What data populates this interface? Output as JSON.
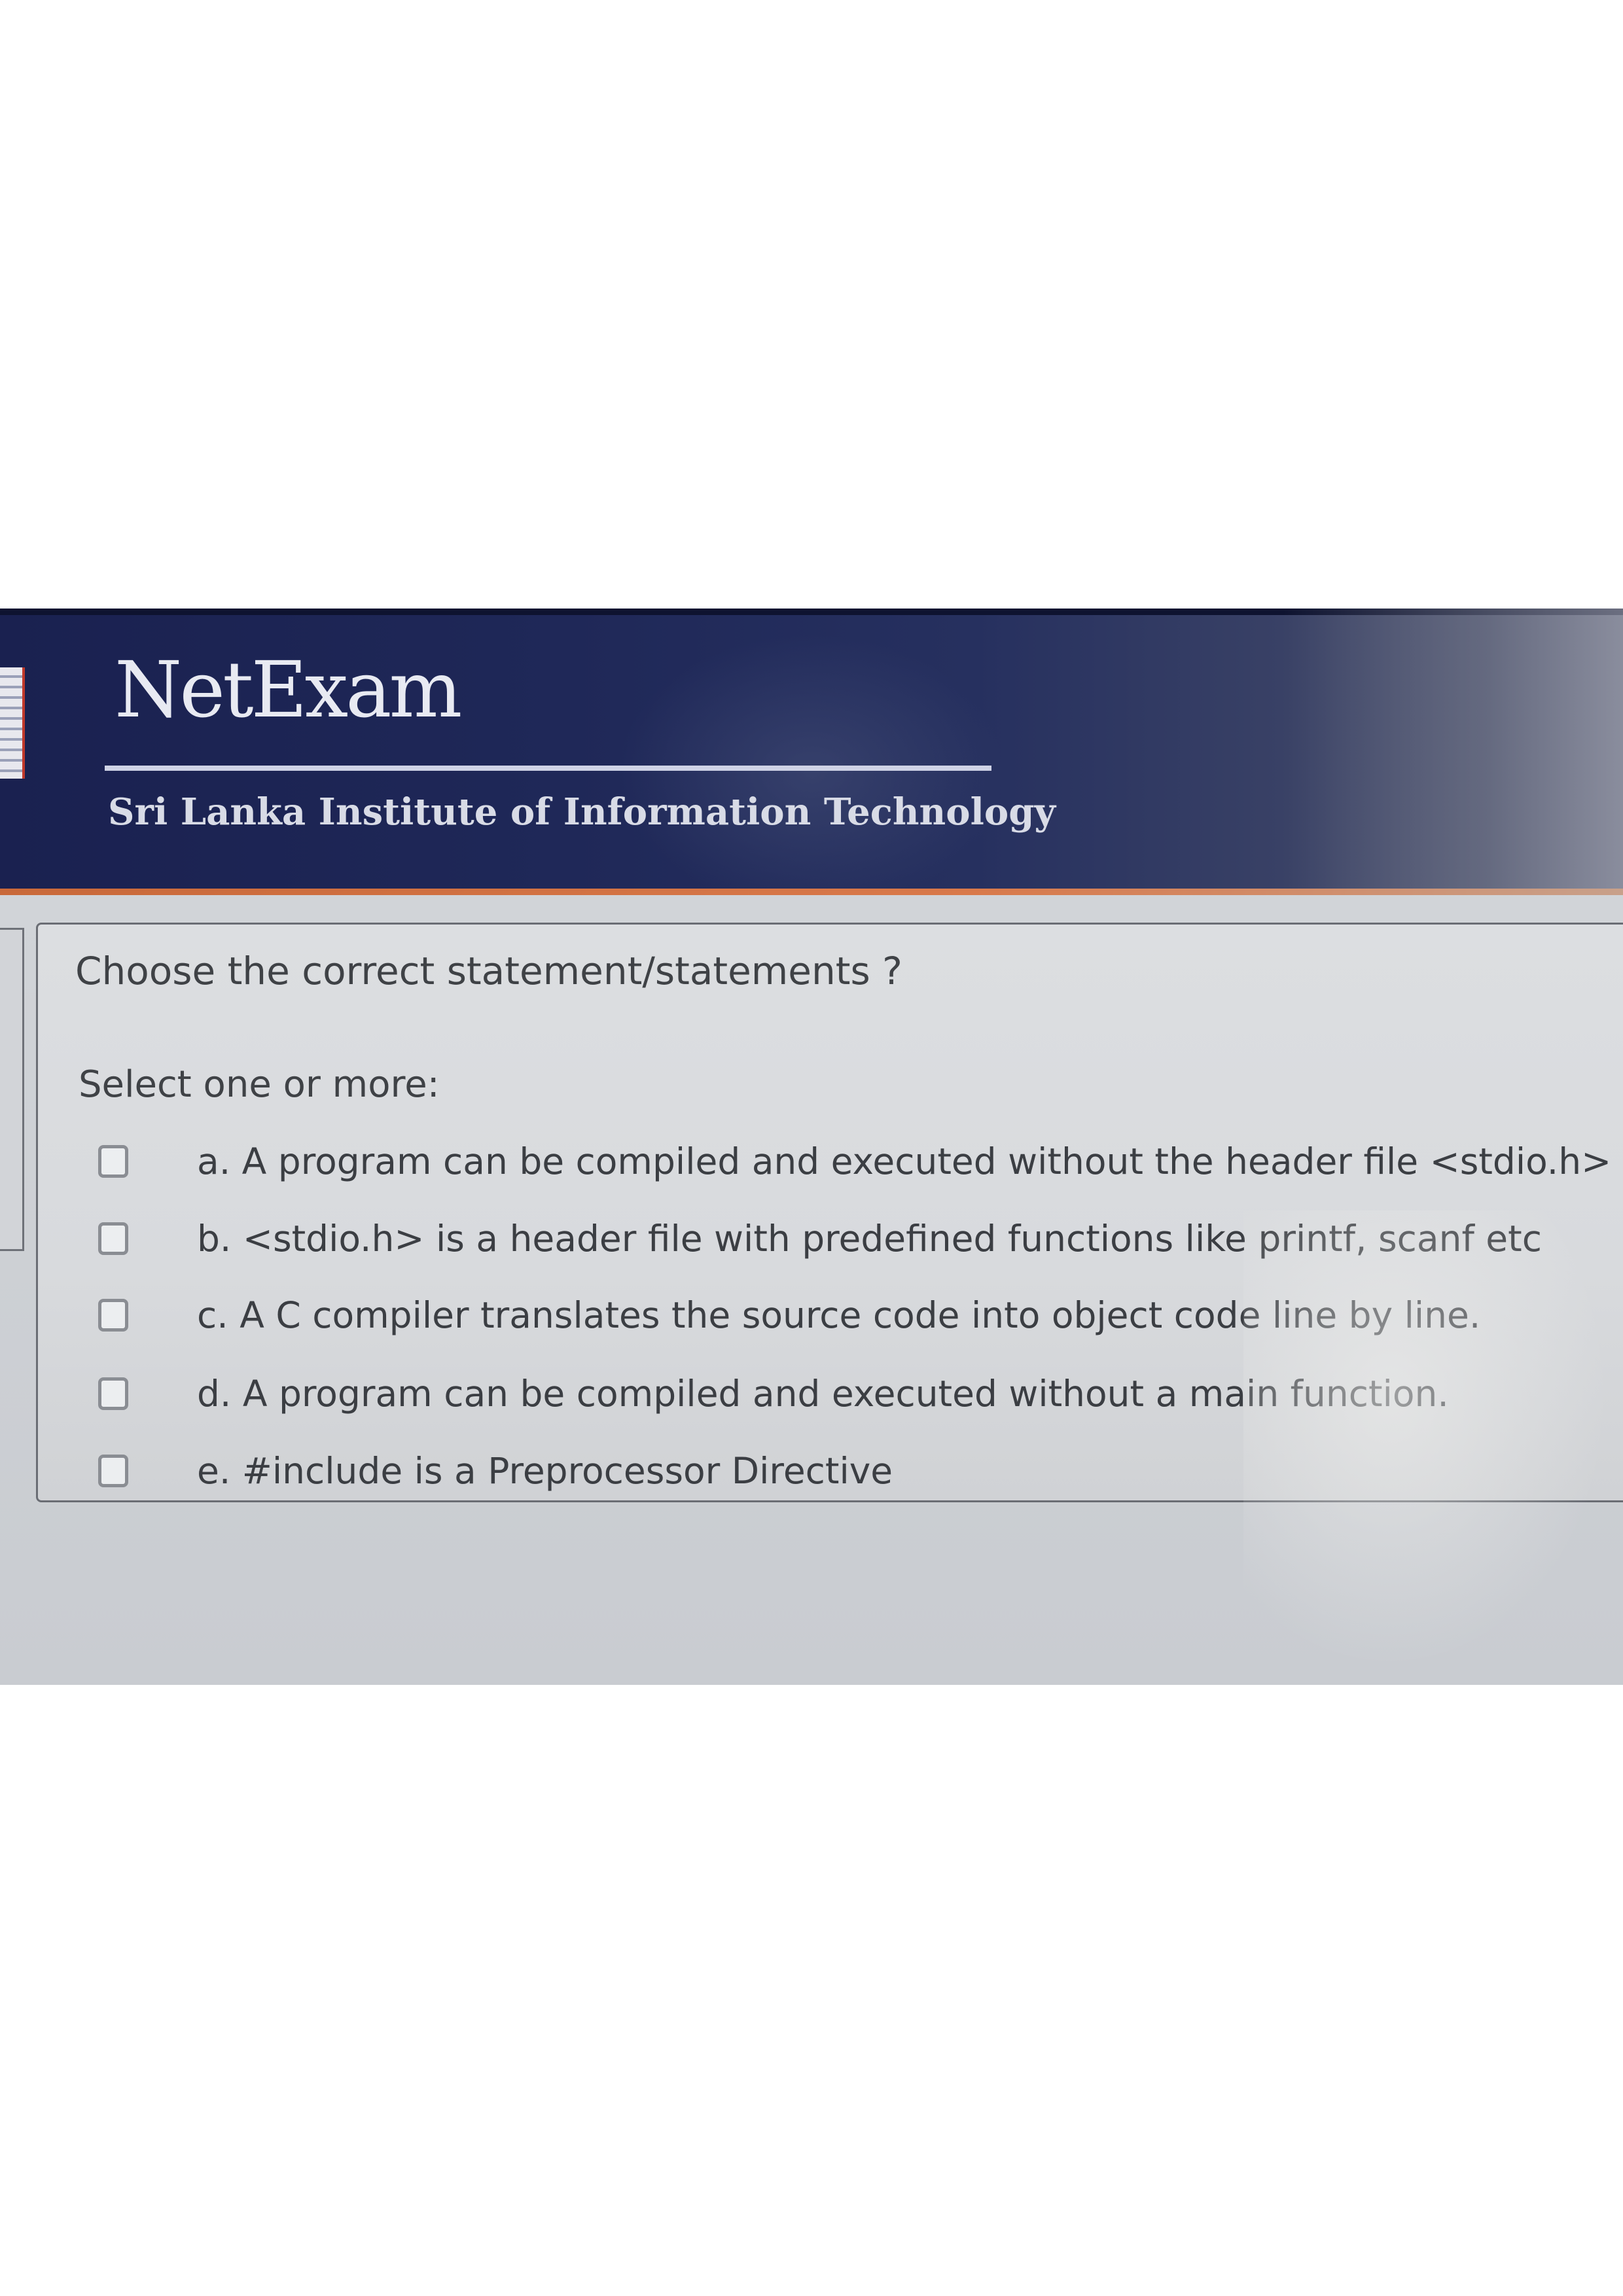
{
  "header": {
    "app_name": "NetExam",
    "institute": "Sri Lanka Institute of Information Technology"
  },
  "question": {
    "prompt": "Choose the correct statement/statements ?",
    "instruction": "Select one or more:",
    "options": [
      {
        "label": "a. A program can be compiled and executed without the header file <stdio.h>",
        "checked": false
      },
      {
        "label": "b. <stdio.h> is a header file with predefined functions like printf, scanf etc",
        "checked": false
      },
      {
        "label": "c. A  C compiler translates the source code into object code line by line.",
        "checked": false
      },
      {
        "label": "d. A program can be compiled and executed without a main function.",
        "checked": false
      },
      {
        "label": "e. #include is a Preprocessor Directive",
        "checked": false
      }
    ]
  },
  "colors": {
    "banner": "#1f2858",
    "accent_line": "#d9794a",
    "card_background": "#d8dadd"
  }
}
